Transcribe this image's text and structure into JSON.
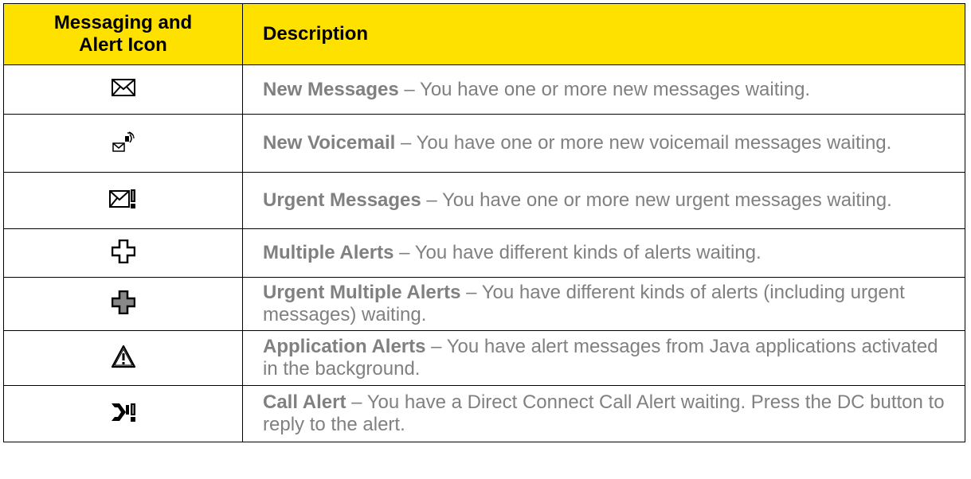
{
  "header": {
    "icon_col": [
      "Messaging and",
      "Alert Icon"
    ],
    "desc_col": "Description"
  },
  "rows": [
    {
      "icon": "envelope-icon",
      "title": "New Messages",
      "sep": " – ",
      "text": "You have one or more new messages waiting."
    },
    {
      "icon": "voicemail-icon",
      "title": "New Voicemail",
      "sep": " – ",
      "text": "You have one or more new voicemail messages waiting."
    },
    {
      "icon": "urgent-envelope-icon",
      "title": "Urgent Messages",
      "sep": " – ",
      "text": "You have one or more new urgent messages waiting."
    },
    {
      "icon": "multiple-alerts-icon",
      "title": "Multiple Alerts",
      "sep": " – ",
      "text": "You have different kinds of alerts waiting."
    },
    {
      "icon": "urgent-multiple-alerts-icon",
      "title": "Urgent Multiple Alerts",
      "sep": " – ",
      "text": "You have different kinds of alerts (including urgent messages) waiting."
    },
    {
      "icon": "warning-triangle-icon",
      "title": "Application Alerts",
      "sep": " – ",
      "text": "You have alert messages from Java applications activated in the background."
    },
    {
      "icon": "call-alert-icon",
      "title": "Call Alert",
      "sep": " – ",
      "text": "You have a Direct Connect Call Alert waiting. Press the DC button to reply to the alert."
    }
  ]
}
